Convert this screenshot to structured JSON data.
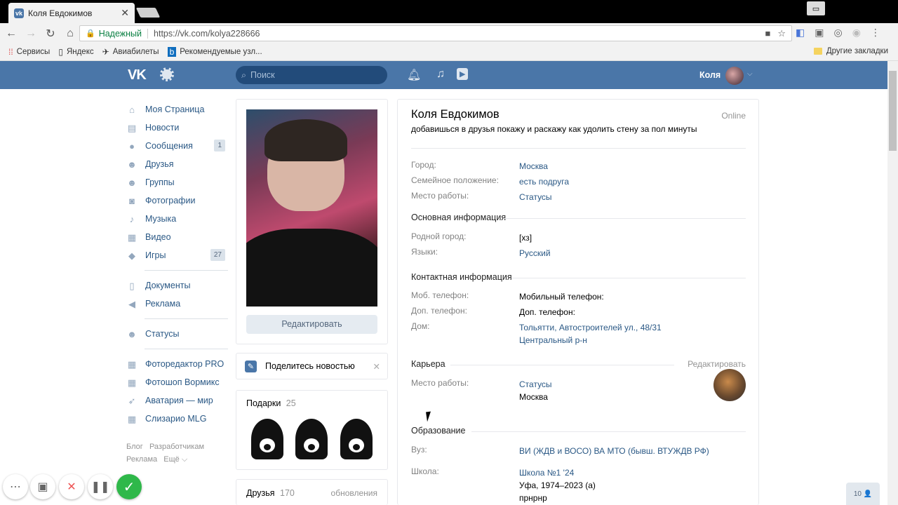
{
  "browser": {
    "tab_title": "Коля Евдокимов",
    "tab_close": "✕",
    "security_label": "Надежный",
    "url": "https://vk.com/kolya228666",
    "bookmarks": [
      {
        "icon": "apps-icon",
        "label": "Сервисы"
      },
      {
        "icon": "page-icon",
        "label": "Яндекс"
      },
      {
        "icon": "plane-icon",
        "label": "Авиабилеты"
      },
      {
        "icon": "bing-icon",
        "label": "Рекомендуемые узл..."
      }
    ],
    "other_bookmarks": "Другие закладки"
  },
  "vk_header": {
    "logo": "VK",
    "search_placeholder": "Поиск",
    "user_name": "Коля"
  },
  "left_nav": {
    "items": [
      {
        "icon": "home-icon",
        "label": "Моя Страница"
      },
      {
        "icon": "news-icon",
        "label": "Новости"
      },
      {
        "icon": "messages-icon",
        "label": "Сообщения",
        "count": "1"
      },
      {
        "icon": "friends-icon",
        "label": "Друзья"
      },
      {
        "icon": "groups-icon",
        "label": "Группы"
      },
      {
        "icon": "camera-icon",
        "label": "Фотографии"
      },
      {
        "icon": "music-icon",
        "label": "Музыка"
      },
      {
        "icon": "video-icon",
        "label": "Видео"
      },
      {
        "icon": "games-icon",
        "label": "Игры",
        "count": "27"
      }
    ],
    "items2": [
      {
        "icon": "documents-icon",
        "label": "Документы"
      },
      {
        "icon": "ads-icon",
        "label": "Реклама"
      }
    ],
    "items3": [
      {
        "icon": "statuses-icon",
        "label": "Статусы"
      }
    ],
    "apps": [
      {
        "icon": "app-icon",
        "label": "Фоторедактор PRO"
      },
      {
        "icon": "app-icon",
        "label": "Фотошоп Вормикс"
      },
      {
        "icon": "rocket-icon",
        "label": "Аватария — мир"
      },
      {
        "icon": "app-icon",
        "label": "Слизарио MLG"
      }
    ],
    "footer": {
      "blog": "Блог",
      "devs": "Разработчикам",
      "ads": "Реклама",
      "more": "Ещё ⌵"
    }
  },
  "profile_card": {
    "edit_button": "Редактировать",
    "share": "Поделитесь новостью",
    "gifts_label": "Подарки",
    "gifts_count": "25",
    "friends_label": "Друзья",
    "friends_count": "170",
    "friends_updates": "обновления"
  },
  "info": {
    "name": "Коля Евдокимов",
    "online": "Online",
    "status": "добавишься в друзья покажу и раскажу как удолить стену за пол минуты",
    "rows1": [
      {
        "k": "Город:",
        "v": "Москва"
      },
      {
        "k": "Семейное положение:",
        "v": "есть подруга"
      },
      {
        "k": "Место работы:",
        "v": "Статусы"
      }
    ],
    "sect_main": "Основная информация",
    "rows2": [
      {
        "k": "Родной город:",
        "v": "[хз]"
      },
      {
        "k": "Языки:",
        "v": "Русский"
      }
    ],
    "sect_contact": "Контактная информация",
    "rows3": [
      {
        "k": "Моб. телефон:",
        "v": "Мобильный телефон:"
      },
      {
        "k": "Доп. телефон:",
        "v": "Доп. телефон:"
      },
      {
        "k": "Дом:",
        "v": "Тольятти, Автостроителей ул., 48/31"
      }
    ],
    "home_district": "Центральный р-н",
    "sect_career": "Карьера",
    "career_edit": "Редактировать",
    "career_k": "Место работы:",
    "career_v1": "Статусы",
    "career_v2": "Москва",
    "sect_edu": "Образование",
    "uni_k": "Вуз:",
    "uni_v": "ВИ (ЖДВ и ВОСО) ВА МТО (бывш. ВТУЖДВ РФ)",
    "school_k": "Школа:",
    "school_v1": "Школа №1 '24",
    "school_v2": "Уфа, 1974–2023 (а)",
    "school_v3": "прнрнр"
  },
  "overlay": {
    "badge": "10 👤"
  }
}
